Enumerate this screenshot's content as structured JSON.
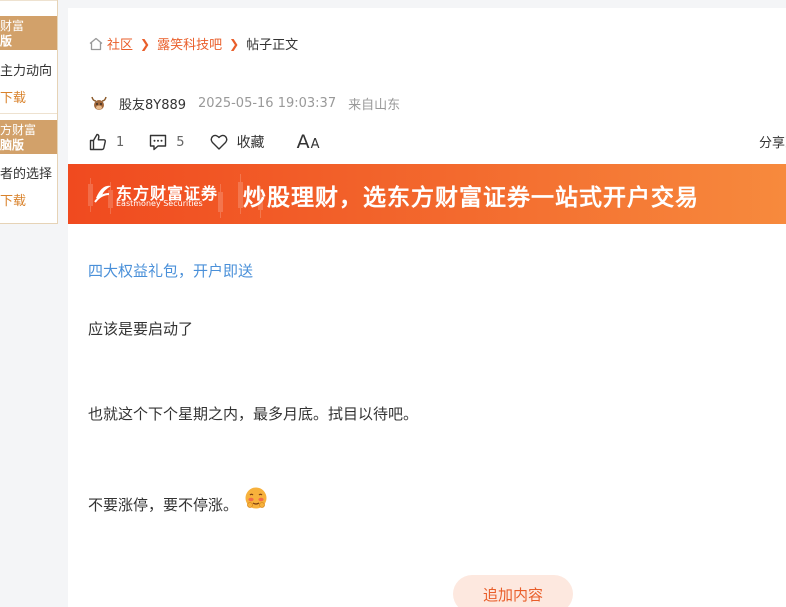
{
  "sidebar": {
    "promos": [
      {
        "title_line1": "财富",
        "title_line2": "版",
        "description": "主力动向",
        "download_label": "下载"
      },
      {
        "title_line1": "方财富",
        "title_line2": "脑版",
        "description": "者的选择",
        "download_label": "下载"
      }
    ]
  },
  "breadcrumb": {
    "items": [
      {
        "label": "社区"
      },
      {
        "label": "露笑科技吧"
      },
      {
        "label": "帖子正文"
      }
    ]
  },
  "post": {
    "author": "股友8Y889",
    "time": "2025-05-16 19:03:37",
    "from": "来自山东",
    "actions": {
      "like_count": "1",
      "comment_count": "5",
      "favorite_label": "收藏",
      "font_big": "A",
      "font_small": "A",
      "share_label": "分享到"
    },
    "banner": {
      "logo_cn": "东方财富证券",
      "logo_en": "Eastmoney Securities",
      "slogan": "炒股理财，选东方财富证券一站式开户交易"
    },
    "promo_link": "四大权益礼包，开户即送",
    "paragraphs": [
      "应该是要启动了",
      "也就这个下个星期之内，最多月底。拭目以待吧。",
      "不要涨停，要不停涨。"
    ],
    "add_content_label": "追加内容"
  },
  "colors": {
    "accent": "#e95e2a",
    "link_blue": "#4a90d9",
    "banner_start": "#f04a1f",
    "banner_end": "#f78a3d",
    "sidebar_gold": "#d2a16a"
  }
}
